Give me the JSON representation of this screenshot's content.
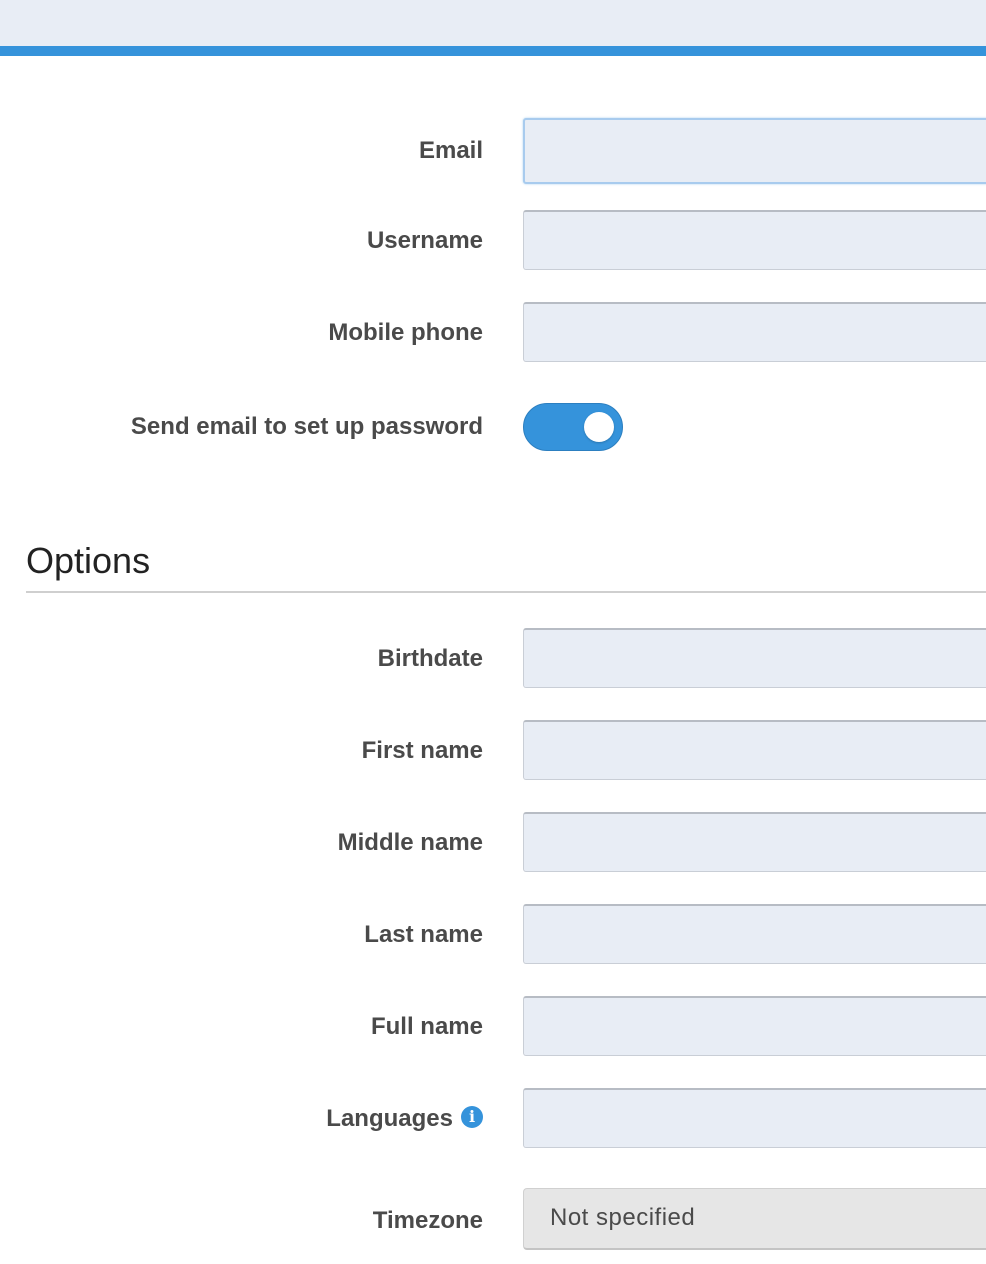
{
  "form": {
    "email_label": "Email",
    "username_label": "Username",
    "mobile_phone_label": "Mobile phone",
    "send_email_label": "Send email to set up password",
    "send_email_enabled": true
  },
  "options": {
    "title": "Options",
    "birthdate_label": "Birthdate",
    "first_name_label": "First name",
    "middle_name_label": "Middle name",
    "last_name_label": "Last name",
    "full_name_label": "Full name",
    "languages_label": "Languages",
    "languages_info_icon": "i",
    "timezone_label": "Timezone",
    "timezone_value": "Not specified"
  },
  "colors": {
    "accent": "#3593db",
    "field_bg": "#e8edf5",
    "select_bg": "#e6e6e6"
  }
}
